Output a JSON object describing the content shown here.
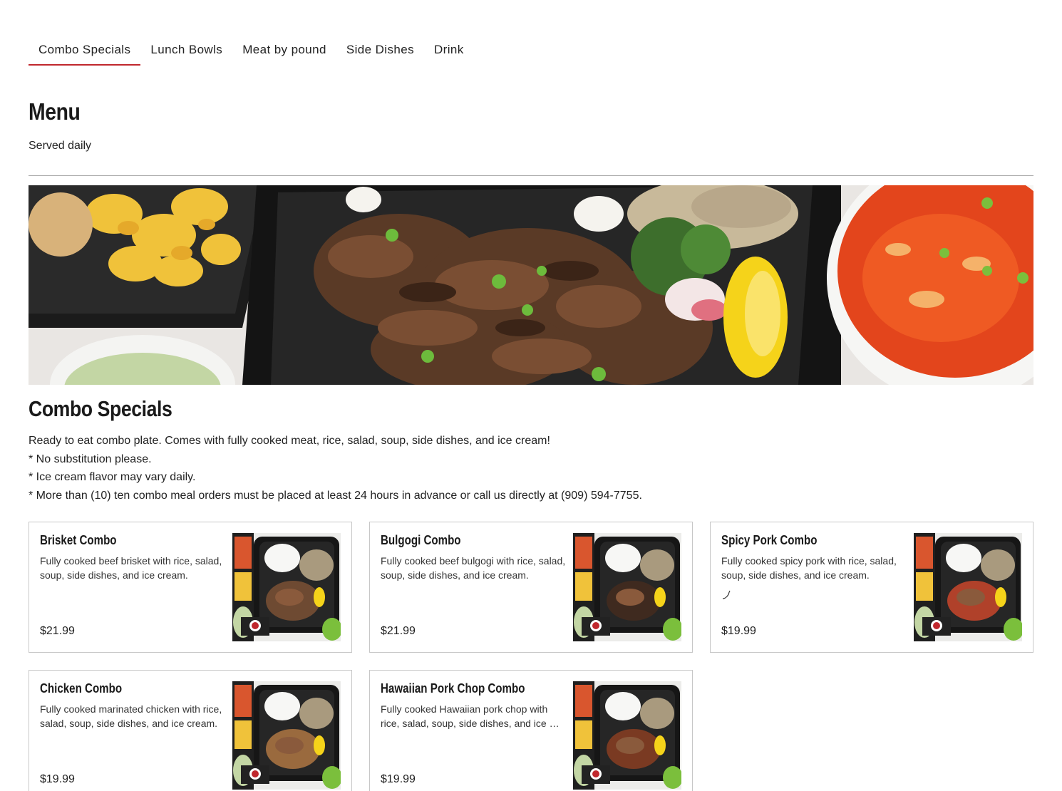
{
  "tabs": [
    {
      "label": "Combo Specials",
      "active": true
    },
    {
      "label": "Lunch Bowls"
    },
    {
      "label": "Meat by pound"
    },
    {
      "label": "Side Dishes"
    },
    {
      "label": "Drink"
    }
  ],
  "menu": {
    "title": "Menu",
    "subtitle": "Served daily"
  },
  "section": {
    "title": "Combo Specials",
    "description": [
      "Ready to eat combo plate. Comes with fully cooked meat, rice, salad, soup, side dishes, and ice cream!",
      "* No substitution please.",
      "* Ice cream flavor may vary daily.",
      "* More than (10) ten combo meal orders must be placed at least 24 hours in advance or call us directly at (909) 594-7755."
    ]
  },
  "items": [
    {
      "name": "Brisket Combo",
      "description": "Fully cooked beef brisket with rice, salad, soup, side dishes, and ice cream.",
      "price": "$21.99",
      "icon": "brisket-combo-photo"
    },
    {
      "name": "Bulgogi Combo",
      "description": "Fully cooked beef bulgogi with rice, salad, soup, side dishes, and ice cream.",
      "price": "$21.99",
      "icon": "bulgogi-combo-photo"
    },
    {
      "name": "Spicy Pork Combo",
      "description": "Fully cooked spicy pork with rice, salad, soup, side dishes, and ice cream.",
      "price": "$19.99",
      "spicy": true,
      "spice_icon": "chili-pepper-icon",
      "icon": "spicy-pork-combo-photo"
    },
    {
      "name": "Chicken Combo",
      "description": "Fully cooked marinated chicken with rice, salad, soup, side dishes, and ice cream.",
      "price": "$19.99",
      "icon": "chicken-combo-photo"
    },
    {
      "name": "Hawaiian Pork Chop Combo",
      "description": "Fully cooked Hawaiian pork chop with rice, salad, soup, side dishes, and ice …",
      "price": "$19.99",
      "icon": "hawaiian-pork-chop-combo-photo"
    }
  ],
  "colors": {
    "accent": "#c0272d",
    "border": "#c7c7c7",
    "text": "#1a1a1a"
  }
}
